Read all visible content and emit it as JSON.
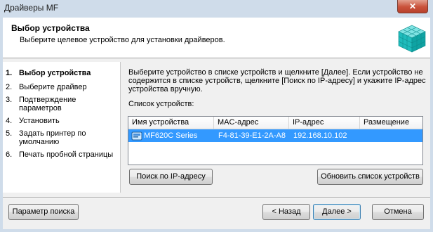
{
  "window": {
    "title": "Драйверы MF",
    "close_label": "✕"
  },
  "header": {
    "title": "Выбор устройства",
    "subtitle": "Выберите целевое устройство для установки драйверов."
  },
  "steps": [
    {
      "num": "1.",
      "label": "Выбор устройства"
    },
    {
      "num": "2.",
      "label": "Выберите драйвер"
    },
    {
      "num": "3.",
      "label": "Подтверждение параметров"
    },
    {
      "num": "4.",
      "label": "Установить"
    },
    {
      "num": "5.",
      "label": "Задать принтер по умолчанию"
    },
    {
      "num": "6.",
      "label": "Печать пробной страницы"
    }
  ],
  "content": {
    "instruction": "Выберите устройство в списке устройств и щелкните [Далее]. Если устройство не содержится в списке устройств, щелкните [Поиск по IP-адресу] и укажите IP-адрес устройства вручную.",
    "list_label": "Список устройств:",
    "columns": [
      "Имя устройства",
      "MAC-адрес",
      "IP-адрес",
      "Размещение"
    ],
    "rows": [
      {
        "name": "MF620C Series",
        "mac": "F4-81-39-E1-2A-A8",
        "ip": "192.168.10.102",
        "location": ""
      }
    ],
    "search_ip_button": "Поиск по IP-адресу",
    "refresh_button": "Обновить список устройств"
  },
  "footer": {
    "search_params_button": "Параметр поиска",
    "back_button": "< Назад",
    "next_button": "Далее >",
    "cancel_button": "Отмена"
  }
}
